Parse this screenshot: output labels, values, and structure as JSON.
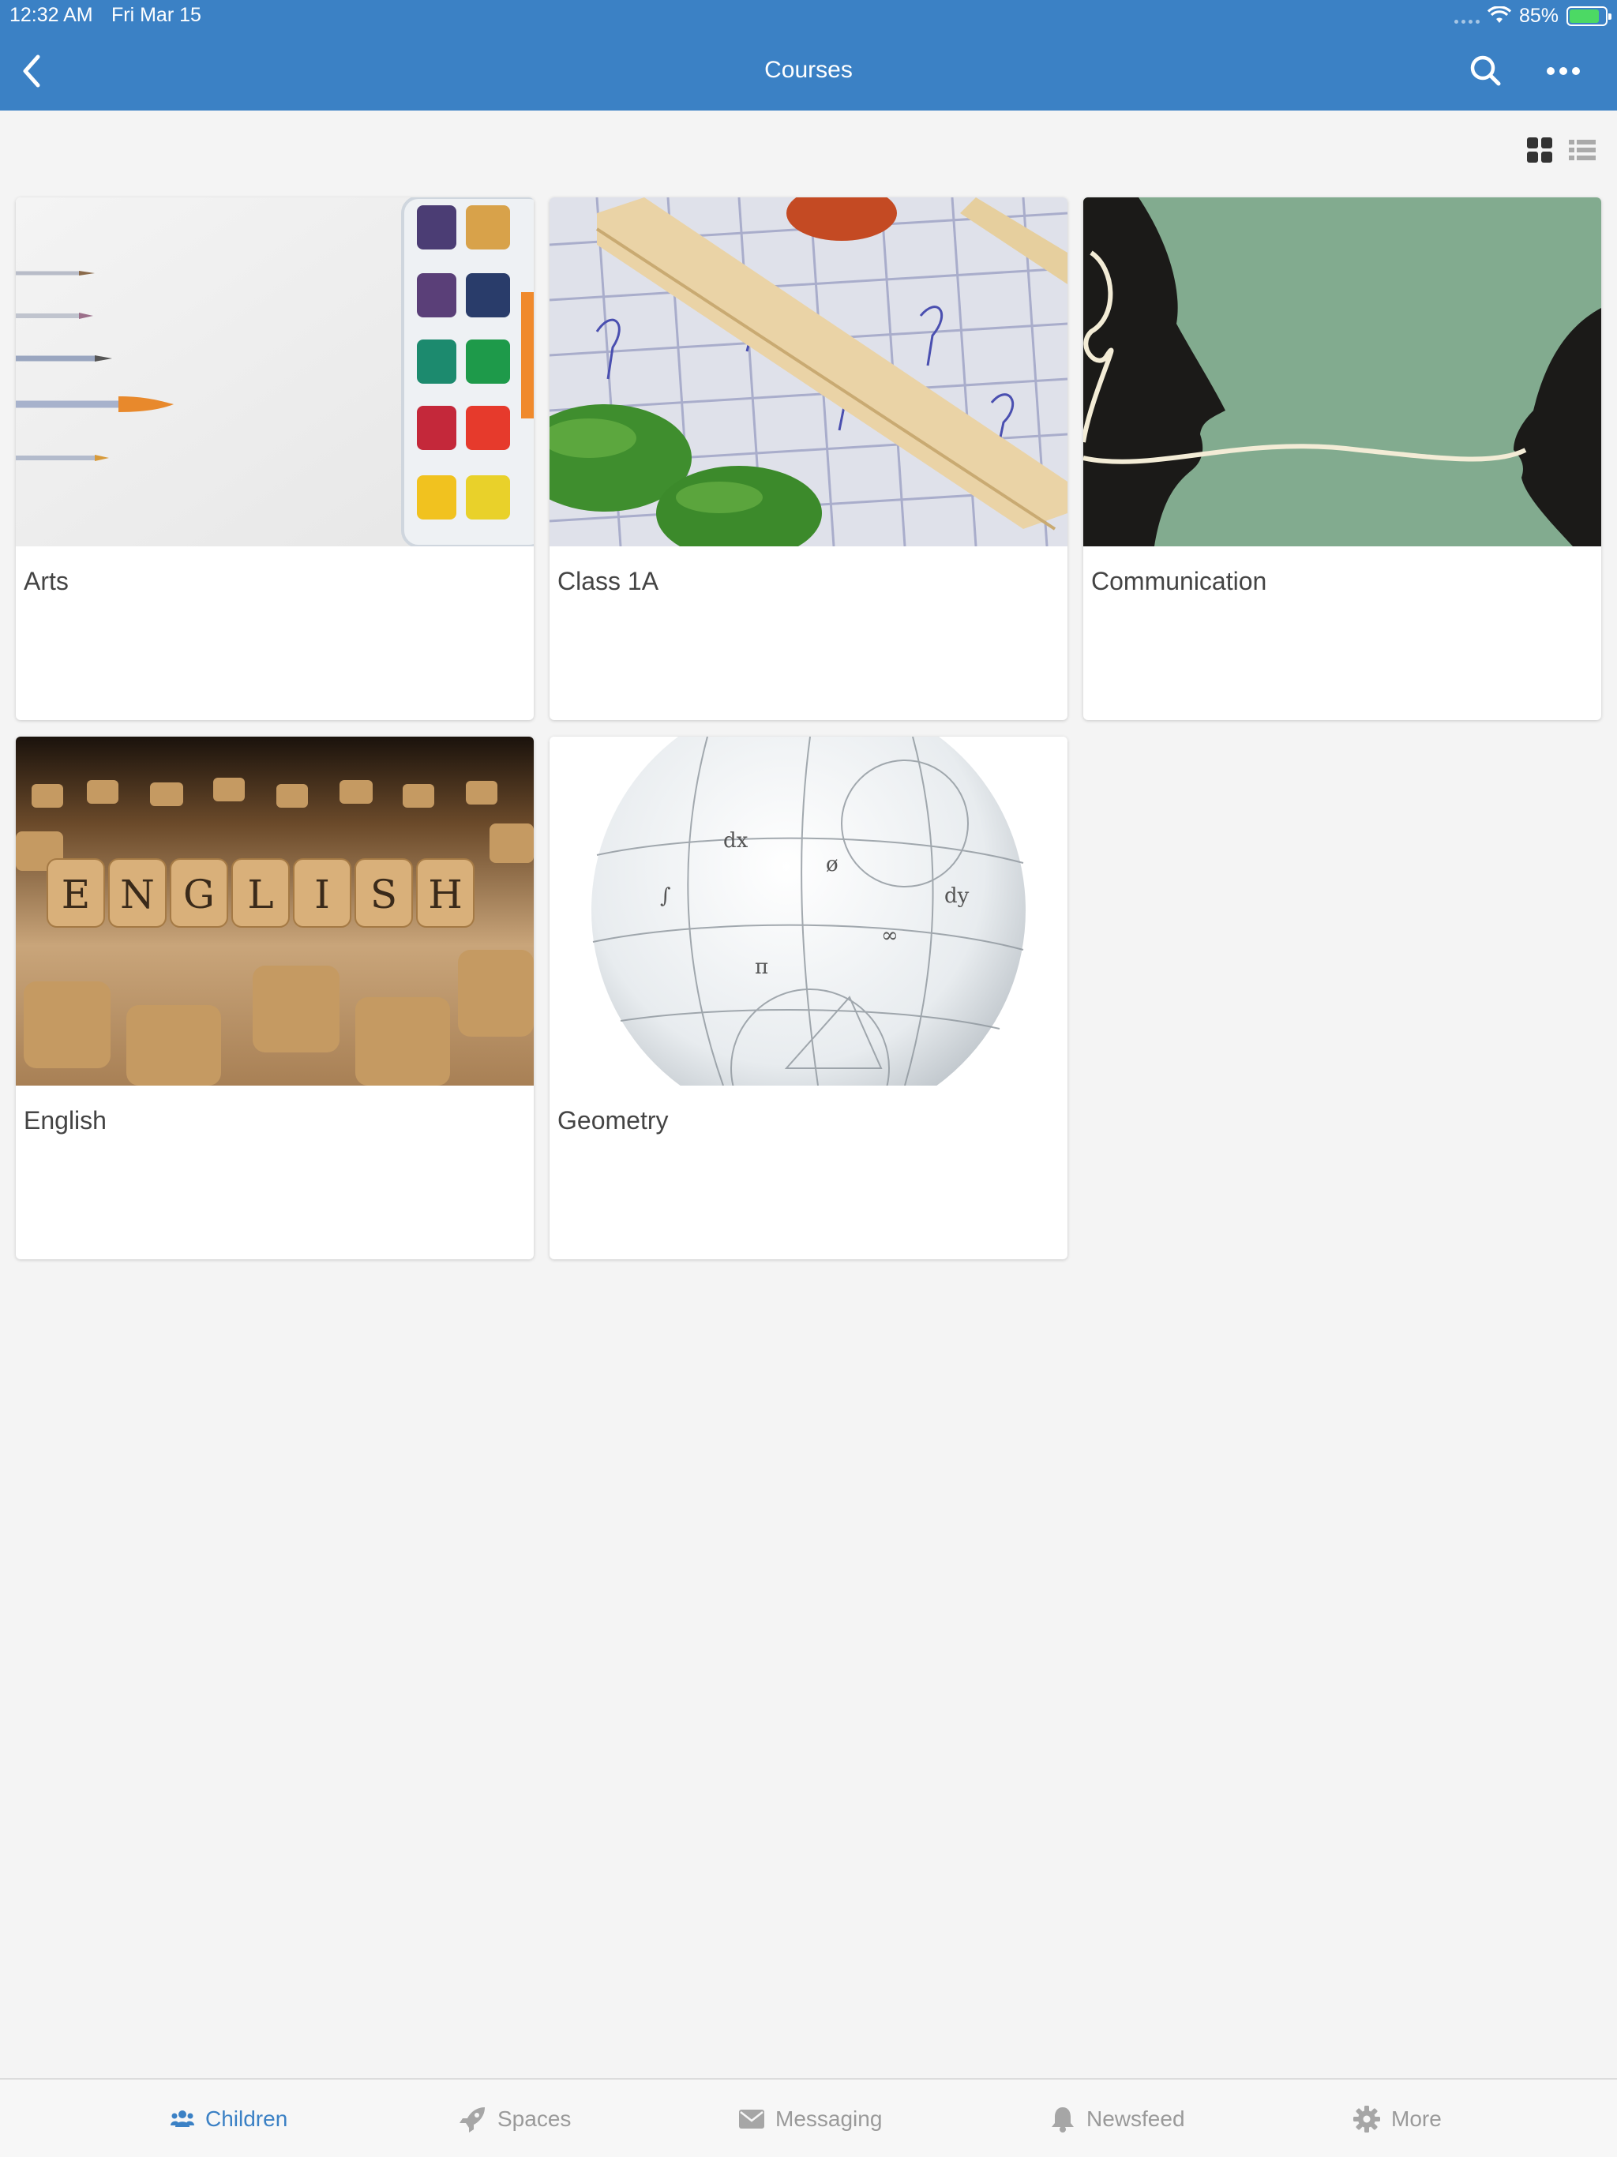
{
  "status_bar": {
    "time": "12:32 AM",
    "date": "Fri Mar 15",
    "battery": "85%",
    "battery_level": 0.85
  },
  "header": {
    "title": "Courses",
    "back_icon": "chevron-left-icon",
    "search_icon": "search-icon",
    "more_icon": "ellipsis-icon"
  },
  "view_toggle": {
    "grid_icon": "grid-view-icon",
    "list_icon": "list-view-icon",
    "selected": "grid"
  },
  "courses": [
    {
      "title": "Arts"
    },
    {
      "title": "Class 1A"
    },
    {
      "title": "Communication"
    },
    {
      "title": "English",
      "image_text": "ENGLISH"
    },
    {
      "title": "Geometry"
    }
  ],
  "tabbar": {
    "items": [
      {
        "label": "Children",
        "icon": "users-icon",
        "active": true
      },
      {
        "label": "Spaces",
        "icon": "rocket-icon",
        "active": false
      },
      {
        "label": "Messaging",
        "icon": "envelope-icon",
        "active": false
      },
      {
        "label": "Newsfeed",
        "icon": "bell-icon",
        "active": false
      },
      {
        "label": "More",
        "icon": "gear-icon",
        "active": false
      }
    ]
  },
  "colors": {
    "header": "#3b81c5",
    "active_tab": "#3b81c5",
    "inactive_tab": "#9a9a9a",
    "background": "#f4f4f4"
  }
}
